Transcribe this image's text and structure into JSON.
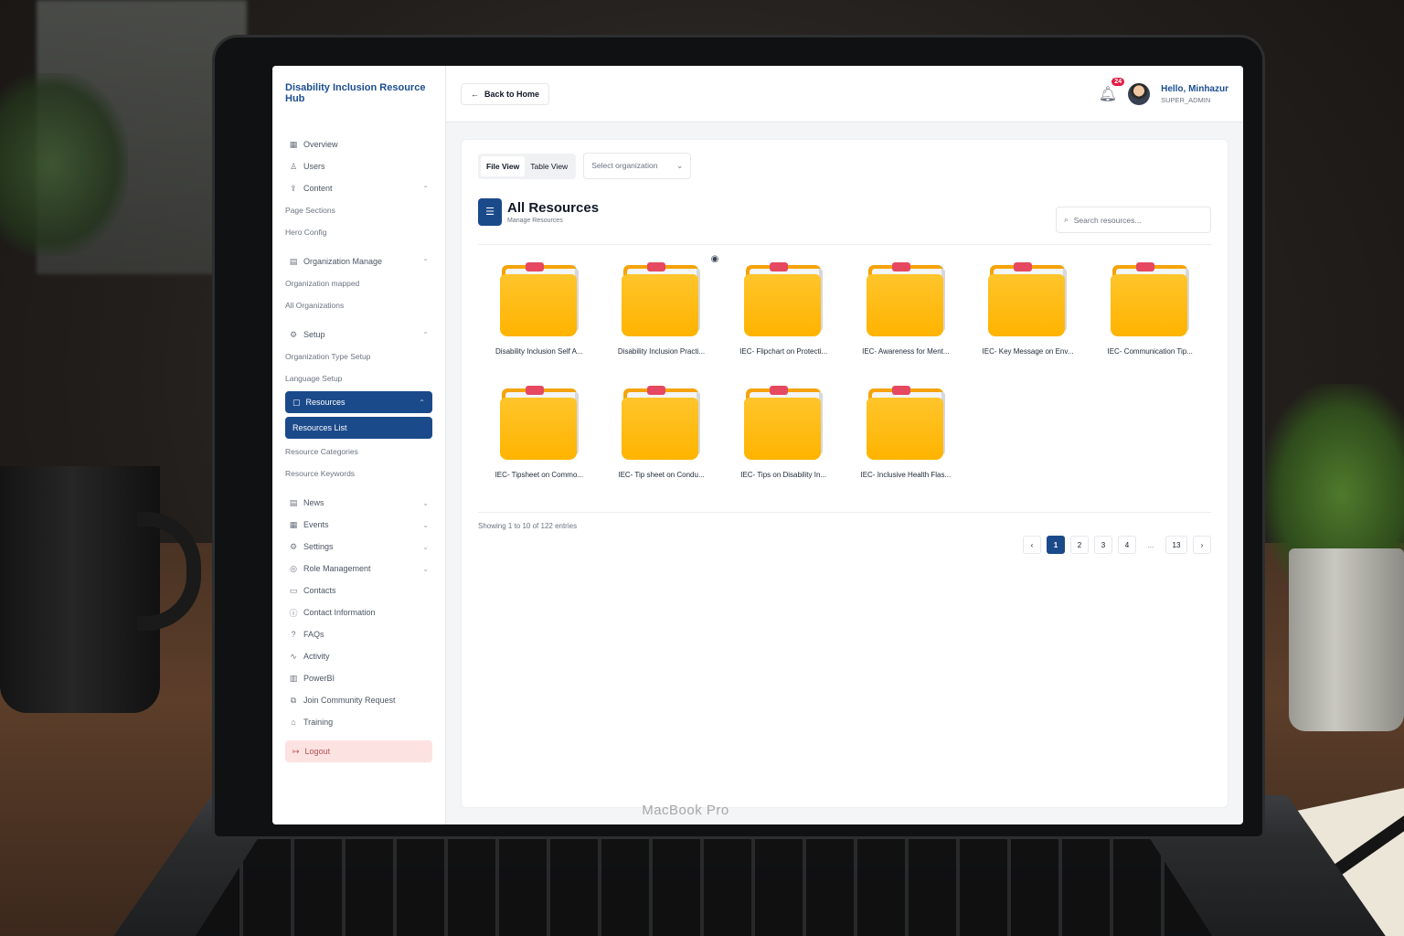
{
  "sidebar": {
    "logo": "Disability Inclusion Resource Hub",
    "overview": "Overview",
    "users": "Users",
    "content": "Content",
    "page_sections": "Page Sections",
    "hero_config": "Hero Config",
    "org_manage": "Organization Manage",
    "org_mapped": "Organization mapped",
    "all_orgs": "All Organizations",
    "setup": "Setup",
    "org_type_setup": "Organization Type Setup",
    "language_setup": "Language Setup",
    "resources": "Resources",
    "resources_list": "Resources List",
    "resource_categories": "Resource Categories",
    "resource_keywords": "Resource Keywords",
    "news": "News",
    "events": "Events",
    "settings": "Settings",
    "role_management": "Role Management",
    "contacts": "Contacts",
    "contact_information": "Contact Information",
    "faqs": "FAQs",
    "activity": "Activity",
    "powerbi": "PowerBI",
    "join_community": "Join Community Request",
    "training": "Training",
    "logout": "Logout"
  },
  "topbar": {
    "back_label": "Back to Home",
    "notification_count": "24",
    "greeting": "Hello, Minhazur",
    "role": "SUPER_ADMIN"
  },
  "toolbar": {
    "tab_file": "File View",
    "tab_table": "Table View",
    "select_placeholder": "Select organization"
  },
  "header": {
    "title": "All Resources",
    "subtitle": "Manage Resources",
    "search_placeholder": "Search resources..."
  },
  "resources": [
    "Disability Inclusion Self A...",
    "Disability Inclusion Practi...",
    "IEC- Flipchart on Protecti...",
    "IEC- Awareness for Ment...",
    "IEC- Key Message on Env...",
    "IEC- Communication Tip...",
    "IEC- Tipsheet on Commo...",
    "IEC- Tip sheet on Condu...",
    "IEC- Tips on Disability In...",
    "IEC- Inclusive Health Flas..."
  ],
  "footer": {
    "showing": "Showing 1 to 10 of 122 entries",
    "pages": [
      "1",
      "2",
      "3",
      "4",
      "...",
      "13"
    ]
  },
  "device": {
    "brand": "MacBook Pro"
  },
  "colors": {
    "primary": "#1b4a8b",
    "folder": "#ffb300",
    "badge": "#e11d48"
  }
}
